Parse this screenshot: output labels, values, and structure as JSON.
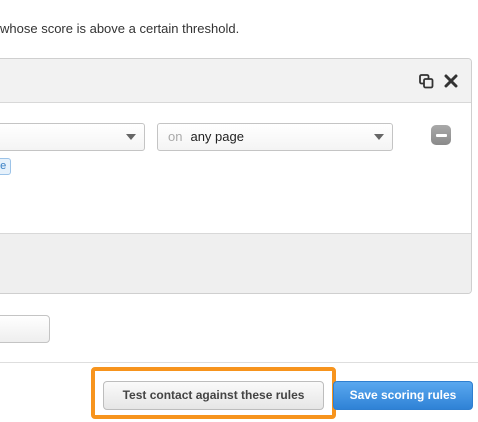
{
  "intro_text": "whose score is above a certain threshold.",
  "rule": {
    "field_select": {
      "value": ""
    },
    "page_select": {
      "prefix": "on",
      "value": "any page"
    },
    "tag_label": "ne"
  },
  "icons": {
    "copy": "copy-icon",
    "close": "close-icon",
    "remove": "minus-icon",
    "caret": "chevron-down-icon"
  },
  "actions": {
    "test_label": "Test contact against these rules",
    "save_label": "Save scoring rules"
  },
  "colors": {
    "highlight": "#f7941d",
    "primary": "#3b8fe0",
    "tag_text": "#3a80c4"
  }
}
